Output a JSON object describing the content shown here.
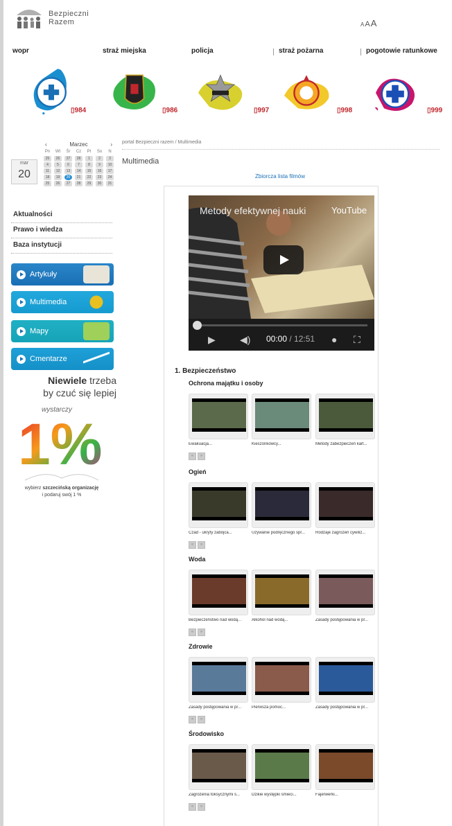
{
  "logo": {
    "line1": "Bezpieczni",
    "line2": "Razem"
  },
  "fontsize": {
    "a1": "A",
    "a2": "A",
    "a3": "A"
  },
  "services": [
    {
      "name": "wopr",
      "number": "984",
      "color": "#1a6fb5"
    },
    {
      "name": "straż miejska",
      "number": "986",
      "color": "#2bb34a"
    },
    {
      "name": "policja",
      "number": "997",
      "color": "#d4c934"
    },
    {
      "name": "straż pożarna",
      "number": "998",
      "color": "#f0a020"
    },
    {
      "name": "pogotowie ratunkowe",
      "number": "999",
      "color": "#c8156c"
    }
  ],
  "calendar": {
    "month_short": "mar",
    "day": "20",
    "month": "Marzec",
    "prev": "‹",
    "next": "›",
    "dow": [
      "Pn",
      "Wt",
      "Śr",
      "Cz",
      "Pt",
      "So",
      "N"
    ],
    "weeks": [
      [
        "25",
        "26",
        "27",
        "28",
        "1",
        "2",
        "3"
      ],
      [
        "4",
        "5",
        "6",
        "7",
        "8",
        "9",
        "10"
      ],
      [
        "11",
        "12",
        "13",
        "14",
        "15",
        "16",
        "17"
      ],
      [
        "18",
        "19",
        "20",
        "21",
        "22",
        "23",
        "24"
      ],
      [
        "25",
        "26",
        "27",
        "28",
        "29",
        "30",
        "31"
      ]
    ],
    "today": "20"
  },
  "nav": [
    "Aktualności",
    "Prawo i wiedza",
    "Baza instytucji"
  ],
  "buttons": [
    {
      "label": "Artykuły",
      "color": "#1a6fb5"
    },
    {
      "label": "Multimedia",
      "color": "#159bd0"
    },
    {
      "label": "Mapy",
      "color": "#16a3b8"
    },
    {
      "label": "Cmentarze",
      "color": "#1590c8"
    }
  ],
  "slogan": {
    "w1": "Niewiele",
    "w2": " trzeba",
    "w3": "by czuć się lepiej"
  },
  "wystarczy": "wystarczy",
  "percent": "1%",
  "onetext": {
    "line1a": "wybierz ",
    "line1b": "szczecińską organizację",
    "line2": "i podaruj swój 1 %"
  },
  "crumb": "portal Bezpieczni razem / Multimedia",
  "title": "Multimedia",
  "fullist": "Zbiorcza lista filmów",
  "video": {
    "title": "Metody efektywnej nauki",
    "brand": "YouTube",
    "time": "00:00",
    "total": " / 12:51"
  },
  "category": "1. Bezpieczeństwo",
  "sections": [
    {
      "name": "Ochrona majątku i osoby",
      "captions": [
        "Ewakuacja...",
        "Kieszonkowcy...",
        "Metody zabezpieczeń kart..."
      ],
      "colors": [
        "#5a6a4a",
        "#6a8a7a",
        "#4a5a3a"
      ]
    },
    {
      "name": "Ogień",
      "captions": [
        "Czad - ukryty zabójca...",
        "Używanie podręcznego spr...",
        "Rodzaje zagrożeń cywiliz..."
      ],
      "colors": [
        "#3a3a2a",
        "#2a2a3a",
        "#3a2a2a"
      ]
    },
    {
      "name": "Woda",
      "captions": [
        "Bezpieczeństwo nad wodą...",
        "Alkohol nad wodą...",
        "Zasady postępowania w pr..."
      ],
      "colors": [
        "#6a3a2a",
        "#8a6a2a",
        "#7a5a5a"
      ]
    },
    {
      "name": "Zdrowie",
      "captions": [
        "Zasady postępowania w pr...",
        "Pierwsza pomoc...",
        "Zasady postępowania w pr..."
      ],
      "colors": [
        "#5a7a9a",
        "#8a5a4a",
        "#2a5a9a"
      ]
    },
    {
      "name": "Środowisko",
      "captions": [
        "Zagrożenia toksycznymi ś...",
        "Dzikie występki śmieci...",
        "Fajerwerki..."
      ],
      "colors": [
        "#6a5a4a",
        "#5a7a4a",
        "#7a4a2a"
      ]
    }
  ],
  "pager": {
    "prev": "«",
    "next": "»"
  }
}
